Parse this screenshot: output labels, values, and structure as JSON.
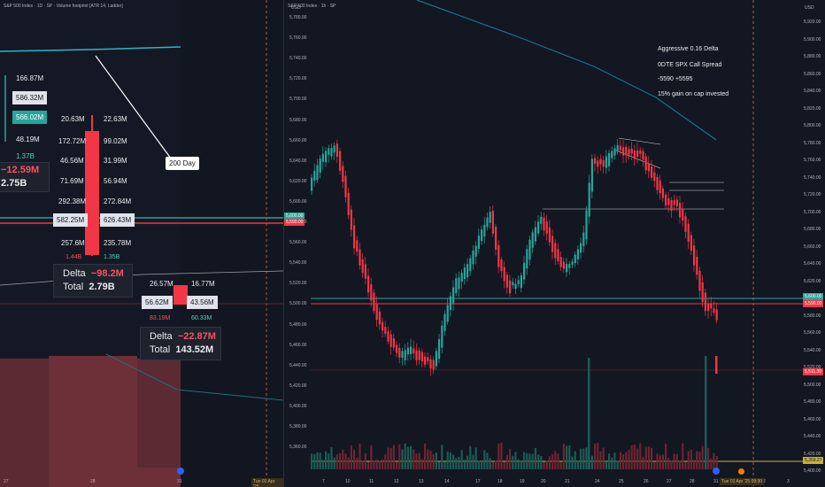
{
  "left": {
    "header": "S&P 500 Index · 1D · SP · Volume footprint [ATR 14, Ladder]",
    "top_levels": [
      "166.87M",
      "586.32M",
      "566.02M",
      "48.19M",
      "1.37B"
    ],
    "top_delta_fragment": "−12.59M",
    "top_total_fragment": "2.75B",
    "mid_left": [
      "20.63M",
      "172.72M",
      "46.56M",
      "71.69M",
      "292.38M",
      "582.25M",
      "257.6M",
      "1.44B"
    ],
    "mid_right": [
      "22.63M",
      "99.02M",
      "31.99M",
      "56.94M",
      "272.84M",
      "626.43M",
      "235.78M",
      "1.35B"
    ],
    "mid_summary": {
      "delta_label": "Delta",
      "delta_value": "−98.2M",
      "total_label": "Total",
      "total_value": "2.79B"
    },
    "bottom_top": [
      "26.57M",
      "16.77M"
    ],
    "bottom_mid": [
      "56.62M",
      "43.56M"
    ],
    "bottom_low": [
      "83.19M",
      "60.33M"
    ],
    "bottom_summary": {
      "delta_label": "Delta",
      "delta_value": "−22.87M",
      "total_label": "Total",
      "total_value": "143.52M"
    },
    "callout": "200 Day",
    "x_labels": [
      "27",
      "28",
      "31"
    ],
    "date_tag": "Tue 01 Apr '25"
  },
  "right": {
    "header": "S&P 500 Index · 1h · SP",
    "currency": "USD",
    "left_axis": [
      "5,780.00",
      "5,760.00",
      "5,740.00",
      "5,720.00",
      "5,700.00",
      "5,680.00",
      "5,660.00",
      "5,640.00",
      "5,620.00",
      "5,600.00",
      "5,580.00",
      "5,560.00",
      "5,540.00",
      "5,520.00",
      "5,500.00",
      "5,480.00",
      "5,460.00",
      "5,440.00",
      "5,420.00",
      "5,400.00",
      "5,380.00",
      "5,360.00"
    ],
    "right_axis": [
      "5,920.00",
      "5,900.00",
      "5,880.00",
      "5,860.00",
      "5,840.00",
      "5,820.00",
      "5,800.00",
      "5,780.00",
      "5,760.00",
      "5,740.00",
      "5,720.00",
      "5,700.00",
      "5,680.00",
      "5,660.00",
      "5,640.00",
      "5,620.00",
      "5,600.00",
      "5,580.00",
      "5,560.00",
      "5,540.00",
      "5,520.00",
      "5,500.00",
      "5,480.00",
      "5,460.00",
      "5,440.00",
      "5,420.00",
      "5,400.00"
    ],
    "note_lines": [
      "Aggressive 0.16 Delta",
      "0DTE SPX Call Spread",
      "-5590 +5595",
      "15% gain on cap invested"
    ],
    "x_labels": [
      "7",
      "10",
      "11",
      "12",
      "13",
      "14",
      "17",
      "18",
      "19",
      "20",
      "21",
      "24",
      "25",
      "26",
      "27",
      "28",
      "31",
      "2",
      "3"
    ],
    "date_tag": "Tue 01 Apr '25  09:30",
    "price_tags": {
      "green": "5,600.00",
      "red": "5,590.00",
      "red2": "5,511.30",
      "left_green": "5,600.00",
      "left_red": "5,590.00",
      "yellow": "5,359.27"
    }
  },
  "colors": {
    "bull": "#26a69a",
    "bear": "#f23645",
    "grid": "#1e222d",
    "ma": "#2e8fa6"
  }
}
